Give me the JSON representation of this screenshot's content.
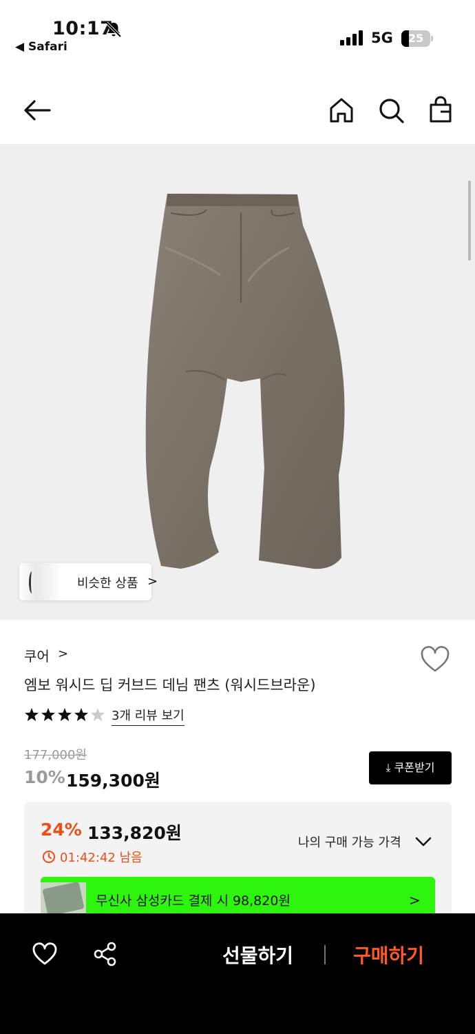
{
  "status_bar": {
    "time": "10:17",
    "back_app": "◀ Safari",
    "network": "5G",
    "battery": "25"
  },
  "header": {
    "icons": [
      "back-arrow-icon",
      "home-icon",
      "search-icon",
      "shopping-bag-icon"
    ]
  },
  "hero": {
    "similar_label": "비슷한 상품",
    "similar_chevron": ">"
  },
  "product": {
    "brand": "쿠어",
    "brand_chevron": ">",
    "title": "엠보 워시드 딥 커브드 데님 팬츠 (워시드브라운)",
    "rating": 4.5,
    "reviews_link": "3개 리뷰 보기",
    "original_price": "177,000원",
    "discount": "10%",
    "price": "159,300원",
    "coupon_label": "⤓ 쿠폰받기"
  },
  "benefit": {
    "percent": "24%",
    "price": "133,820원",
    "timer": "01:42:42 남음",
    "my_price_label": "나의 구매 가능 가격",
    "card_offer": "무신사 삼성카드 결제 시 98,820원",
    "card_chevron": ">",
    "accent_color": "#f04d16",
    "bar_color": "#2df50d"
  },
  "bottom_bar": {
    "gift_label": "선물하기",
    "buy_label": "구매하기",
    "buy_color": "#ff5a1f"
  }
}
